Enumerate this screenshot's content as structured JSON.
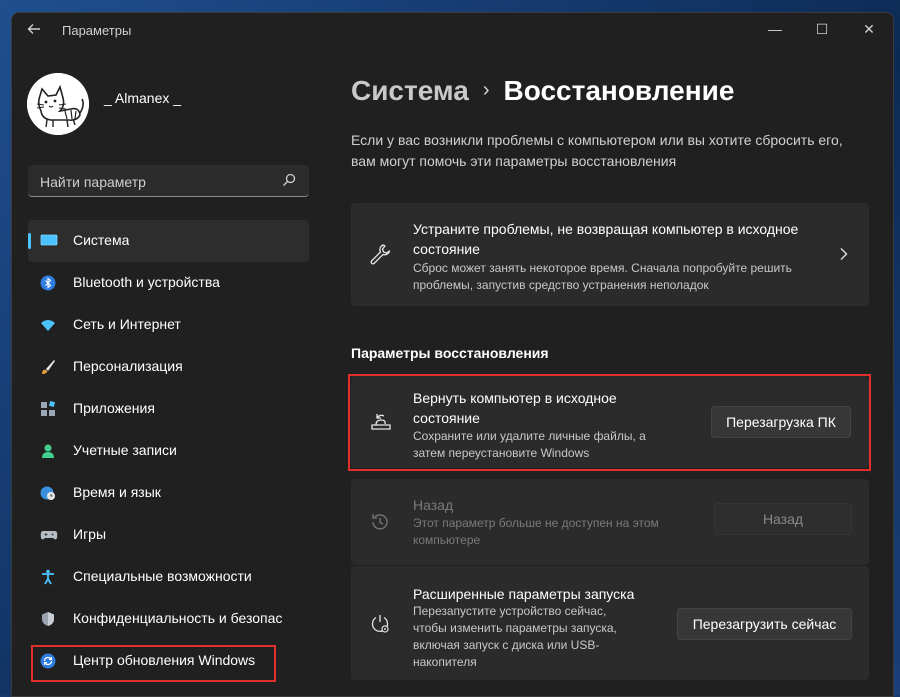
{
  "window": {
    "title": "Параметры",
    "back_icon": "back-arrow-icon",
    "controls": {
      "minimize": "—",
      "maximize": "☐",
      "close": "✕"
    }
  },
  "profile": {
    "username": "_ Almanex _"
  },
  "search": {
    "placeholder": "Найти параметр",
    "icon": "search-icon"
  },
  "sidebar": {
    "items": [
      {
        "label": "Система",
        "icon": "monitor-icon",
        "active": true
      },
      {
        "label": "Bluetooth и устройства",
        "icon": "bluetooth-icon"
      },
      {
        "label": "Сеть и Интернет",
        "icon": "wifi-icon"
      },
      {
        "label": "Персонализация",
        "icon": "brush-icon"
      },
      {
        "label": "Приложения",
        "icon": "apps-icon"
      },
      {
        "label": "Учетные записи",
        "icon": "person-icon"
      },
      {
        "label": "Время и язык",
        "icon": "globe-clock-icon"
      },
      {
        "label": "Игры",
        "icon": "gamepad-icon"
      },
      {
        "label": "Специальные возможности",
        "icon": "accessibility-icon"
      },
      {
        "label": "Конфиденциальность и безопас",
        "icon": "shield-icon"
      },
      {
        "label": "Центр обновления Windows",
        "icon": "update-icon",
        "highlighted": true
      }
    ]
  },
  "breadcrumb": {
    "parent": "Система",
    "separator": "›",
    "current": "Восстановление"
  },
  "intro": "Если у вас возникли проблемы с компьютером или вы хотите сбросить его, вам могут помочь эти параметры восстановления",
  "troubleshoot_card": {
    "title": "Устраните проблемы, не возвращая компьютер в исходное состояние",
    "description": "Сброс может занять некоторое время. Сначала попробуйте решить проблемы, запустив средство устранения неполадок",
    "icon": "wrench-icon"
  },
  "section_title": "Параметры восстановления",
  "options": {
    "reset": {
      "title": "Вернуть компьютер в исходное состояние",
      "description": "Сохраните или удалите личные файлы, а затем переустановите Windows",
      "button": "Перезагрузка ПК",
      "icon": "reset-pc-icon"
    },
    "goback": {
      "title": "Назад",
      "description": "Этот параметр больше не доступен на этом компьютере",
      "button": "Назад",
      "icon": "history-icon"
    },
    "advanced": {
      "title": "Расширенные параметры запуска",
      "description": "Перезапустите устройство сейчас, чтобы изменить параметры запуска, включая запуск с диска или USB-накопителя",
      "button": "Перезагрузить сейчас",
      "icon": "advanced-startup-icon"
    }
  },
  "colors": {
    "accent": "#4cc2ff",
    "highlight": "#e0302c",
    "background": "#202020",
    "card": "#2b2b2b"
  }
}
